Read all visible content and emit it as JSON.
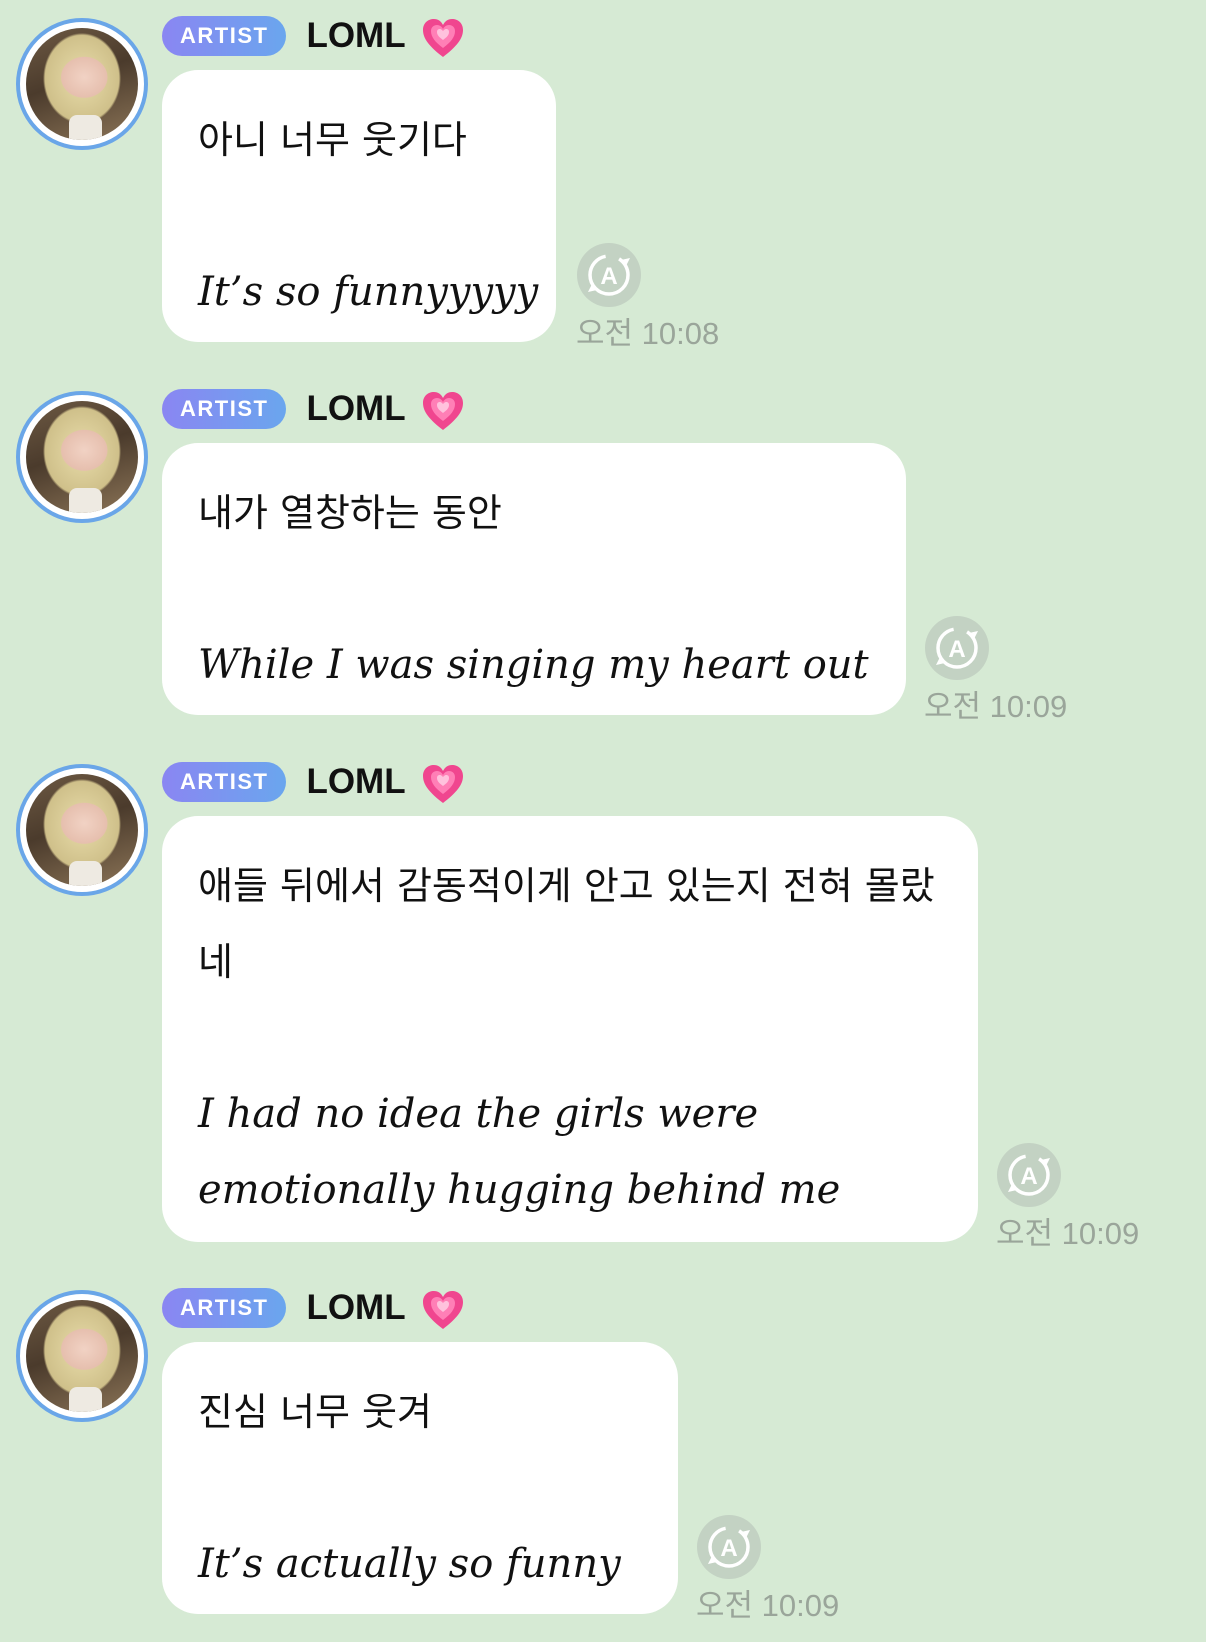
{
  "sender": {
    "badge": "ARTIST",
    "name": "LOML"
  },
  "messages": [
    {
      "lines": [
        "아니 너무 웃기다",
        "",
        "It’s so funnyyyyy"
      ],
      "time": "오전 10:08"
    },
    {
      "lines": [
        "내가 열창하는 동안",
        "",
        "While I was singing my heart out"
      ],
      "time": "오전 10:09"
    },
    {
      "lines": [
        "애들 뒤에서 감동적이게 안고 있는지 전혀 몰랐",
        "네",
        "",
        "I had no idea the girls were",
        "emotionally hugging behind me"
      ],
      "time": "오전 10:09"
    },
    {
      "lines": [
        "진심 너무 웃겨",
        "",
        "It’s actually so funny"
      ],
      "time": "오전 10:09"
    }
  ],
  "icons": {
    "heart": "growing-heart-icon",
    "translate": "auto-translate-icon"
  },
  "colors": {
    "background": "#d6ead4",
    "bubble": "#ffffff",
    "badge_start": "#8a86f2",
    "badge_end": "#6aa6ee",
    "time": "#9aa59a"
  }
}
